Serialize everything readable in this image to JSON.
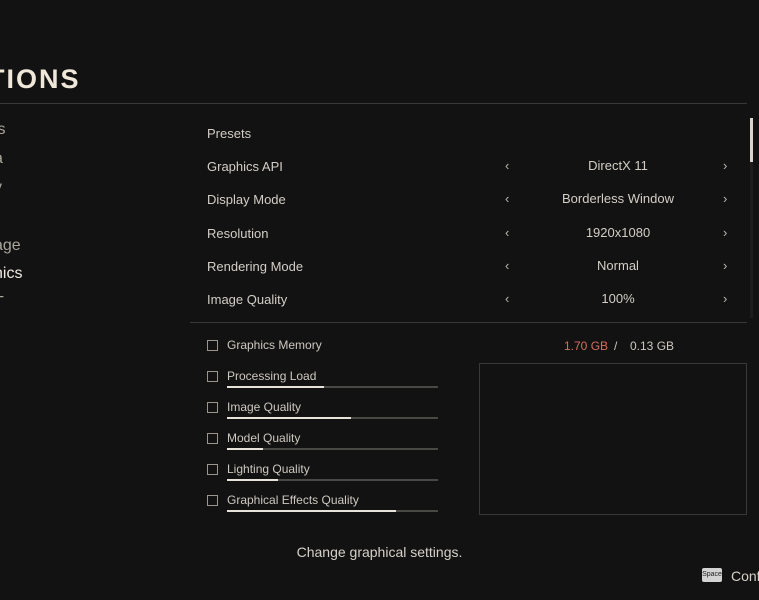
{
  "header": {
    "title": "TIONS"
  },
  "sidebar": {
    "items": [
      {
        "label": "ls",
        "active": false
      },
      {
        "label": "a",
        "active": false
      },
      {
        "label": "y",
        "active": false
      },
      {
        "label": "age",
        "active": false
      },
      {
        "label": "hics",
        "active": true
      },
      {
        "label": "T",
        "active": false
      },
      {
        "label": "t",
        "active": false
      }
    ]
  },
  "settings": {
    "presets_label": "Presets",
    "rows": [
      {
        "label": "Graphics API",
        "value": "DirectX 11"
      },
      {
        "label": "Display Mode",
        "value": "Borderless Window"
      },
      {
        "label": "Resolution",
        "value": "1920x1080"
      },
      {
        "label": "Rendering Mode",
        "value": "Normal"
      },
      {
        "label": "Image Quality",
        "value": "100%"
      }
    ],
    "arrow_left": "‹",
    "arrow_right": "›"
  },
  "memory": {
    "label": "Graphics Memory",
    "used": "1.70 GB",
    "separator": "/",
    "total": "0.13 GB",
    "used_color": "#d36f5e"
  },
  "loads": [
    {
      "label": "Processing Load",
      "level": 0.46
    },
    {
      "label": "Image Quality",
      "level": 0.59
    },
    {
      "label": "Model Quality",
      "level": 0.17
    },
    {
      "label": "Lighting Quality",
      "level": 0.24
    },
    {
      "label": "Graphical Effects Quality",
      "level": 0.8
    }
  ],
  "footer": {
    "description": "Change graphical settings.",
    "space_key": "Space",
    "confirm_label": "Conf"
  }
}
